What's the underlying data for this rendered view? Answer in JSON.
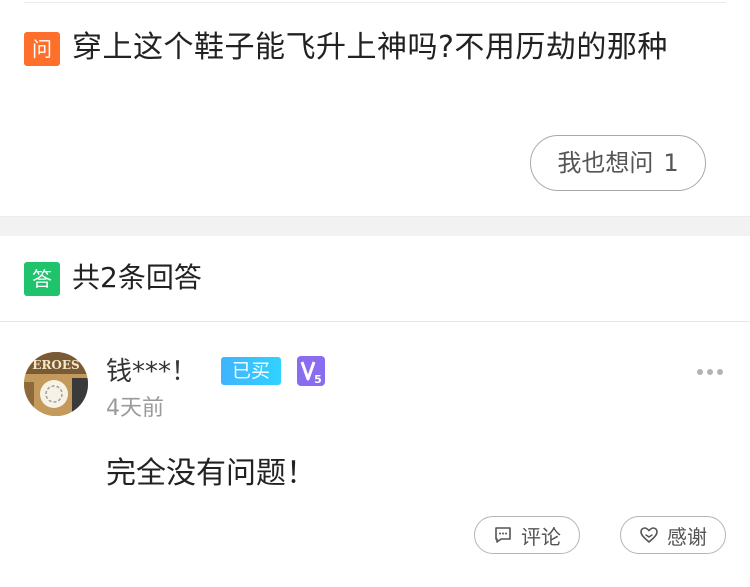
{
  "question": {
    "badge": "问",
    "text": "穿上这个鞋子能飞升上神吗?不用历劫的那种",
    "ask_label": "我也想问",
    "ask_count": "1"
  },
  "answers": {
    "badge": "答",
    "count_label": "共2条回答",
    "items": [
      {
        "user": "钱***！",
        "bought_badge": "已买",
        "vip_level": "5",
        "time_ago": "4天前",
        "text": "完全没有问题！",
        "comment_label": "评论",
        "thank_label": "感谢"
      }
    ]
  },
  "icons": {
    "vip": "vip-level-icon",
    "more": "more-dots-icon",
    "comment": "comment-icon",
    "thank": "heart-hand-icon"
  },
  "colors": {
    "question_badge": "#ff6f2c",
    "answer_badge": "#1fc36b",
    "bought_badge": "#3fb4ff",
    "vip": "#8a6cf0"
  }
}
